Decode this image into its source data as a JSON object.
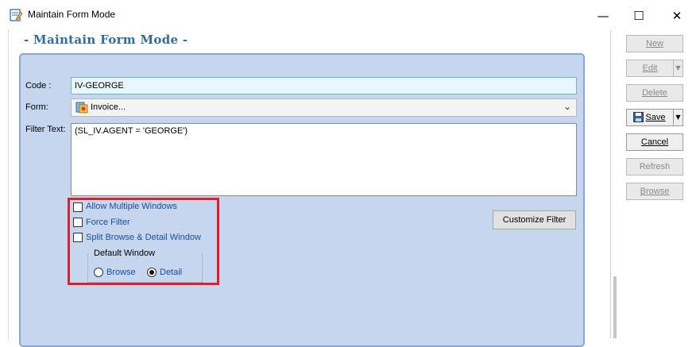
{
  "window": {
    "title": "Maintain Form Mode"
  },
  "header": {
    "title": "- Maintain Form Mode -"
  },
  "form": {
    "code_label": "Code :",
    "code_value": "IV-GEORGE",
    "form_label": "Form:",
    "form_value": "Invoice...",
    "filter_label": "Filter Text:",
    "filter_value": "(SL_IV.AGENT = 'GEORGE')"
  },
  "options": {
    "allow_multiple_windows": {
      "label": "Allow Multiple Windows",
      "checked": false
    },
    "force_filter": {
      "label": "Force Filter",
      "checked": false
    },
    "split_browse_detail": {
      "label": "Split Browse & Detail Window",
      "checked": false
    },
    "default_window": {
      "title": "Default Window",
      "options": [
        "Browse",
        "Detail"
      ],
      "selected": "Detail"
    }
  },
  "customize_filter_label": "Customize Filter",
  "side_buttons": {
    "new": "New",
    "edit": "Edit",
    "delete": "Delete",
    "save": "Save",
    "cancel": "Cancel",
    "refresh": "Refresh",
    "browse": "Browse"
  },
  "colors": {
    "accent": "#2e6ca4",
    "panel": "#c5d6ee",
    "highlight": "#e21f26"
  },
  "icons": [
    "app-icon",
    "minimize-icon",
    "maximize-icon",
    "close-icon",
    "invoice-icon",
    "chevron-down-icon",
    "save-icon"
  ]
}
